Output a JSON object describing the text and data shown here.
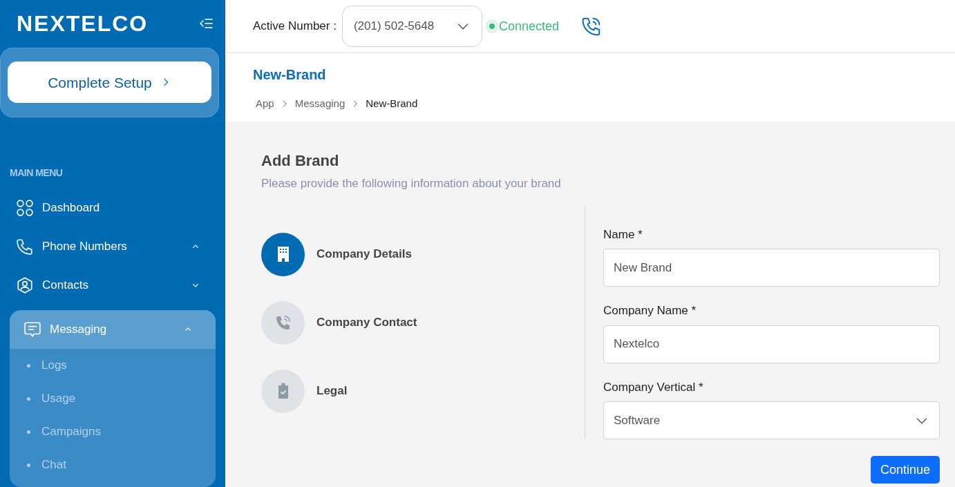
{
  "sidebar": {
    "logo": "NEXTELCO",
    "setup_button": "Complete Setup",
    "section_title": "MAIN MENU",
    "items": [
      {
        "label": "Dashboard",
        "selected": false
      },
      {
        "label": "Phone Numbers",
        "expanded": true,
        "selected": false
      },
      {
        "label": "Contacts",
        "expanded": false,
        "selected": false
      },
      {
        "label": "Messaging",
        "expanded": true,
        "selected": true,
        "children": [
          {
            "label": "Logs"
          },
          {
            "label": "Usage"
          },
          {
            "label": "Campaigns"
          },
          {
            "label": "Chat"
          }
        ]
      }
    ]
  },
  "topbar": {
    "active_number_label": "Active Number :",
    "active_number": "(201) 502-5648",
    "status": "Connected"
  },
  "page": {
    "title": "New-Brand",
    "breadcrumb": [
      "App",
      "Messaging",
      "New-Brand"
    ]
  },
  "form": {
    "title": "Add Brand",
    "subtitle": "Please provide the following information about your brand",
    "steps": [
      {
        "label": "Company Details",
        "selected": true
      },
      {
        "label": "Company Contact",
        "selected": false
      },
      {
        "label": "Legal",
        "selected": false
      }
    ],
    "fields": [
      {
        "kind": "input",
        "label": "Name *",
        "value": "New Brand"
      },
      {
        "kind": "input",
        "label": "Company Name *",
        "value": "Nextelco"
      },
      {
        "kind": "select",
        "label": "Company Vertical *",
        "value": "Software"
      }
    ],
    "submit": "Continue"
  }
}
